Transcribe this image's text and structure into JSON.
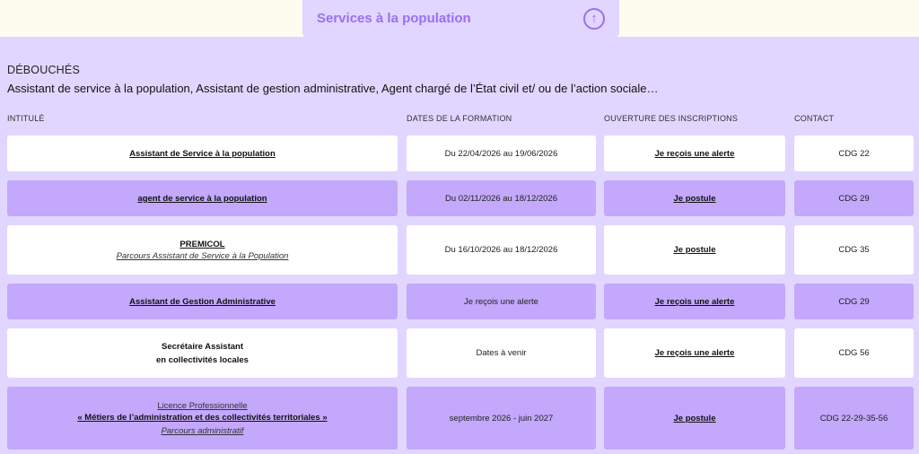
{
  "tab": {
    "title": "Services à la population",
    "icon": "arrow-up-circle-icon"
  },
  "debouches": {
    "label": "DÉBOUCHÉS",
    "text": "Assistant de service à la population, Assistant de gestion administrative, Agent chargé de l’État civil et/ ou de l’action sociale…"
  },
  "columns": [
    "INTITULÉ",
    "DATES DE LA FORMATION",
    "OUVERTURE DES INSCRIPTIONS",
    "CONTACT"
  ],
  "rows": [
    {
      "title": "Assistant de Service à la population",
      "dates": "Du 22/04/2026 au 19/06/2026",
      "action": "Je reçois une alerte",
      "contact": "CDG 22"
    },
    {
      "title": "agent de service à la population",
      "dates": "Du 02/11/2026 au 18/12/2026",
      "action": "Je postule",
      "contact": "CDG 29"
    },
    {
      "title": "PREMICOL",
      "subtitle": "Parcours Assistant de Service à la Population",
      "dates": "Du 16/10/2026 au 18/12/2026",
      "action": "Je postule",
      "contact": "CDG 35"
    },
    {
      "title": "Assistant de Gestion Administrative",
      "dates": "Je reçois une alerte",
      "action": "Je reçois une alerte",
      "contact": "CDG 29"
    },
    {
      "title_line1": "Secrétaire Assistant",
      "title_line2": "en collectivités locales",
      "dates": "Dates à venir",
      "action": "Je reçois une alerte",
      "contact": "CDG 56"
    },
    {
      "pre": "Licence Professionnelle",
      "title": "« Métiers de l’administration et des collectivités territoriales »",
      "subtitle": "Parcours administratif",
      "dates": "septembre 2026 - juin 2027",
      "action": "Je postule",
      "contact": "CDG 22-29-35-56"
    }
  ]
}
